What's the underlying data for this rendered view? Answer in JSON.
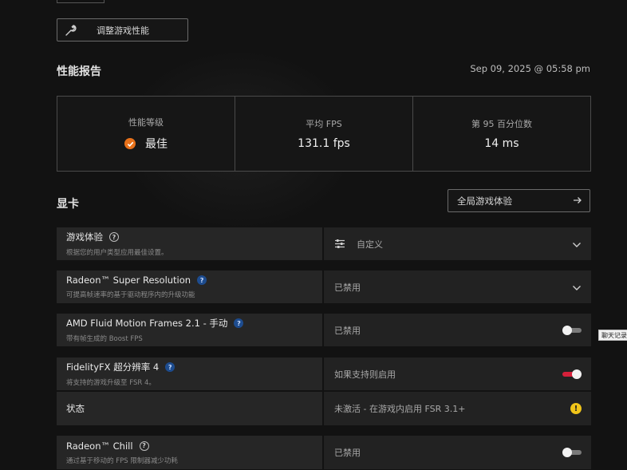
{
  "top_button": {
    "label": "调整游戏性能",
    "icon": "wrench-icon"
  },
  "performance": {
    "title": "性能报告",
    "timestamp": "Sep 09, 2025 @ 05:58 pm",
    "stats": [
      {
        "label": "性能等级",
        "value": "最佳"
      },
      {
        "label": "平均 FPS",
        "value": "131.1 fps"
      },
      {
        "label": "第 95 百分位数",
        "value": "14 ms"
      }
    ]
  },
  "gpu": {
    "title": "显卡",
    "global_button": "全局游戏体验",
    "rows": [
      {
        "title": "游戏体验",
        "desc": "根据您的用户类型应用最佳设置。",
        "value": "自定义"
      },
      {
        "title": "Radeon™ Super Resolution",
        "desc": "可提高帧速率的基于驱动程序内的升级功能",
        "value": "已禁用"
      },
      {
        "title": "AMD Fluid Motion Frames 2.1 - 手动",
        "desc": "带有帧生成的 Boost FPS",
        "value": "已禁用",
        "toggle": "off"
      },
      {
        "title": "FidelityFX 超分辨率 4",
        "desc": "将支持的游戏升级至 FSR 4。",
        "value": "如果支持则启用",
        "toggle": "on"
      },
      {
        "title": "状态",
        "value": "未激活 - 在游戏内启用 FSR 3.1+"
      },
      {
        "title": "Radeon™ Chill",
        "desc": "通过基于移动的 FPS 限制器减少功耗",
        "value": "已禁用",
        "toggle": "off"
      }
    ]
  },
  "side_tooltip": "聊天记录",
  "colors": {
    "accent_orange": "#e8711a",
    "toggle_on": "#d6203a",
    "warning": "#f0c419",
    "help_blue": "#1d4c8f"
  }
}
